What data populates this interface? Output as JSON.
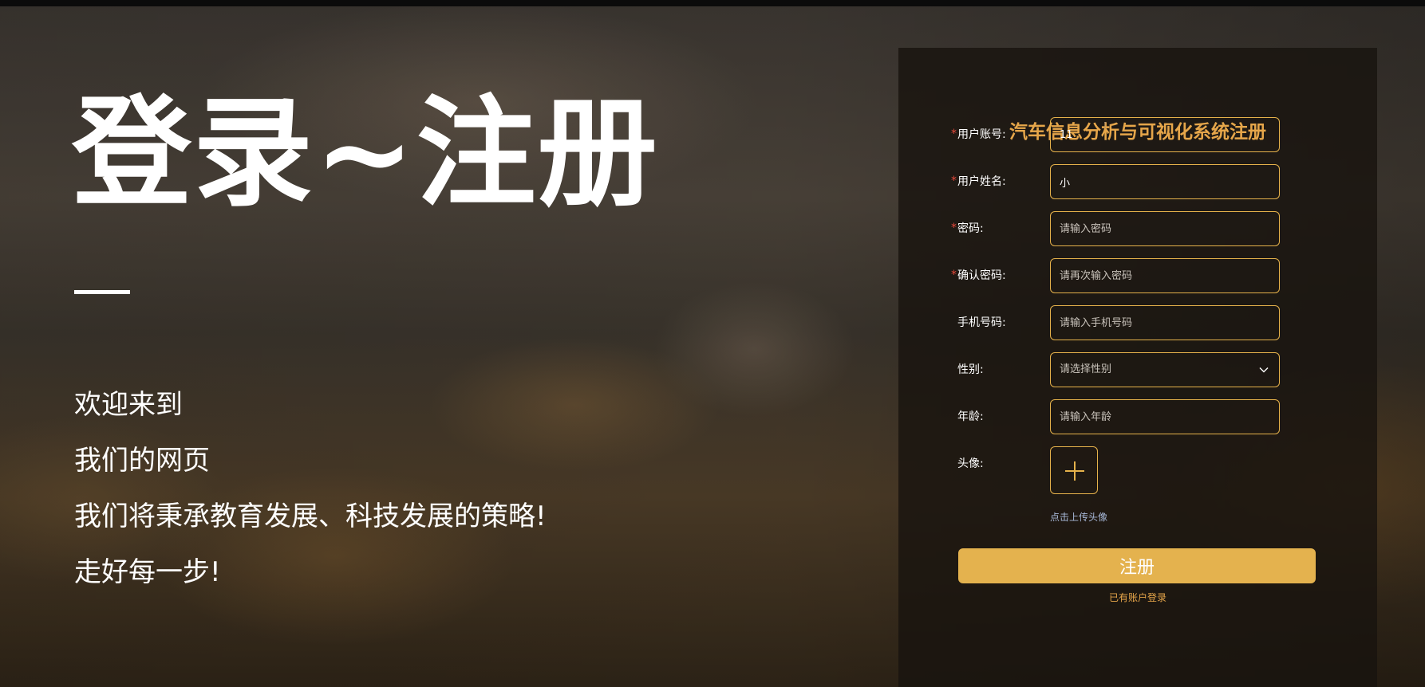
{
  "hero": {
    "title": "登录~注册",
    "lines": [
      "欢迎来到",
      "我们的网页",
      "我们将秉承教育发展、科技发展的策略!",
      "走好每一步!"
    ]
  },
  "form": {
    "title": "汽车信息分析与可视化系统注册",
    "required_mark": "*",
    "fields": {
      "account": {
        "label": "用户账号:",
        "value": "11",
        "placeholder": ""
      },
      "name": {
        "label": "用户姓名:",
        "value": "小",
        "placeholder": ""
      },
      "password": {
        "label": "密码:",
        "value": "",
        "placeholder": "请输入密码"
      },
      "confirm": {
        "label": "确认密码:",
        "value": "",
        "placeholder": "请再次输入密码"
      },
      "phone": {
        "label": "手机号码:",
        "value": "",
        "placeholder": "请输入手机号码"
      },
      "gender": {
        "label": "性别:",
        "placeholder": "请选择性别"
      },
      "age": {
        "label": "年龄:",
        "value": "",
        "placeholder": "请输入年龄"
      },
      "avatar": {
        "label": "头像:",
        "hint": "点击上传头像"
      }
    },
    "submit_label": "注册",
    "login_link": "已有账户登录"
  },
  "colors": {
    "accent": "#e4b24e",
    "title": "#e6a64a",
    "required": "#e5493b",
    "hint": "#a7b8d8"
  },
  "icons": {
    "gender_dropdown": "chevron-down-icon",
    "avatar_upload": "plus-icon",
    "text_cursor": "i-beam-cursor-icon"
  }
}
